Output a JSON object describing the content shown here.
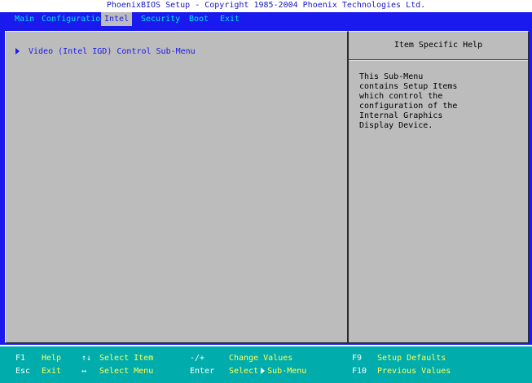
{
  "title": "PhoenixBIOS Setup - Copyright 1985-2004 Phoenix Technologies Ltd.",
  "menu": {
    "items": [
      {
        "label": "Main",
        "active": false
      },
      {
        "label": "Configuration",
        "active": false
      },
      {
        "label": "Intel",
        "active": true
      },
      {
        "label": "Security",
        "active": false
      },
      {
        "label": "Boot",
        "active": false
      },
      {
        "label": "Exit",
        "active": false
      }
    ]
  },
  "main": {
    "submenu_item": "Video (Intel IGD) Control Sub-Menu"
  },
  "help": {
    "title": "Item Specific Help",
    "lines": [
      "This Sub-Menu",
      "contains Setup Items",
      "which control the",
      "configuration of the",
      "Internal Graphics",
      "Display Device."
    ]
  },
  "footer": {
    "row1": {
      "k1": "F1",
      "d1": "Help",
      "k2": "↑↓",
      "d2": "Select Item",
      "k3": "-/+",
      "d3": "Change Values",
      "k4": "F9",
      "d4": "Setup Defaults"
    },
    "row2": {
      "k1": "Esc",
      "d1": "Exit",
      "k2": "↔",
      "d2": "Select Menu",
      "k3": "Enter",
      "d3a": "Select",
      "d3b": "Sub-Menu",
      "k4": "F10",
      "d4": "Previous Values"
    }
  },
  "colors": {
    "background_blue": "#1a1aee",
    "panel_gray": "#bcbcbc",
    "footer_cyan": "#00acac",
    "menu_text_cyan": "#00e4e4",
    "footer_desc_yellow": "#ffff5a"
  },
  "icons": {
    "submenu_pointer": "triangle-right-icon",
    "select_item_keys": "up-down-arrows-icon",
    "select_menu_keys": "left-right-arrows-icon"
  }
}
